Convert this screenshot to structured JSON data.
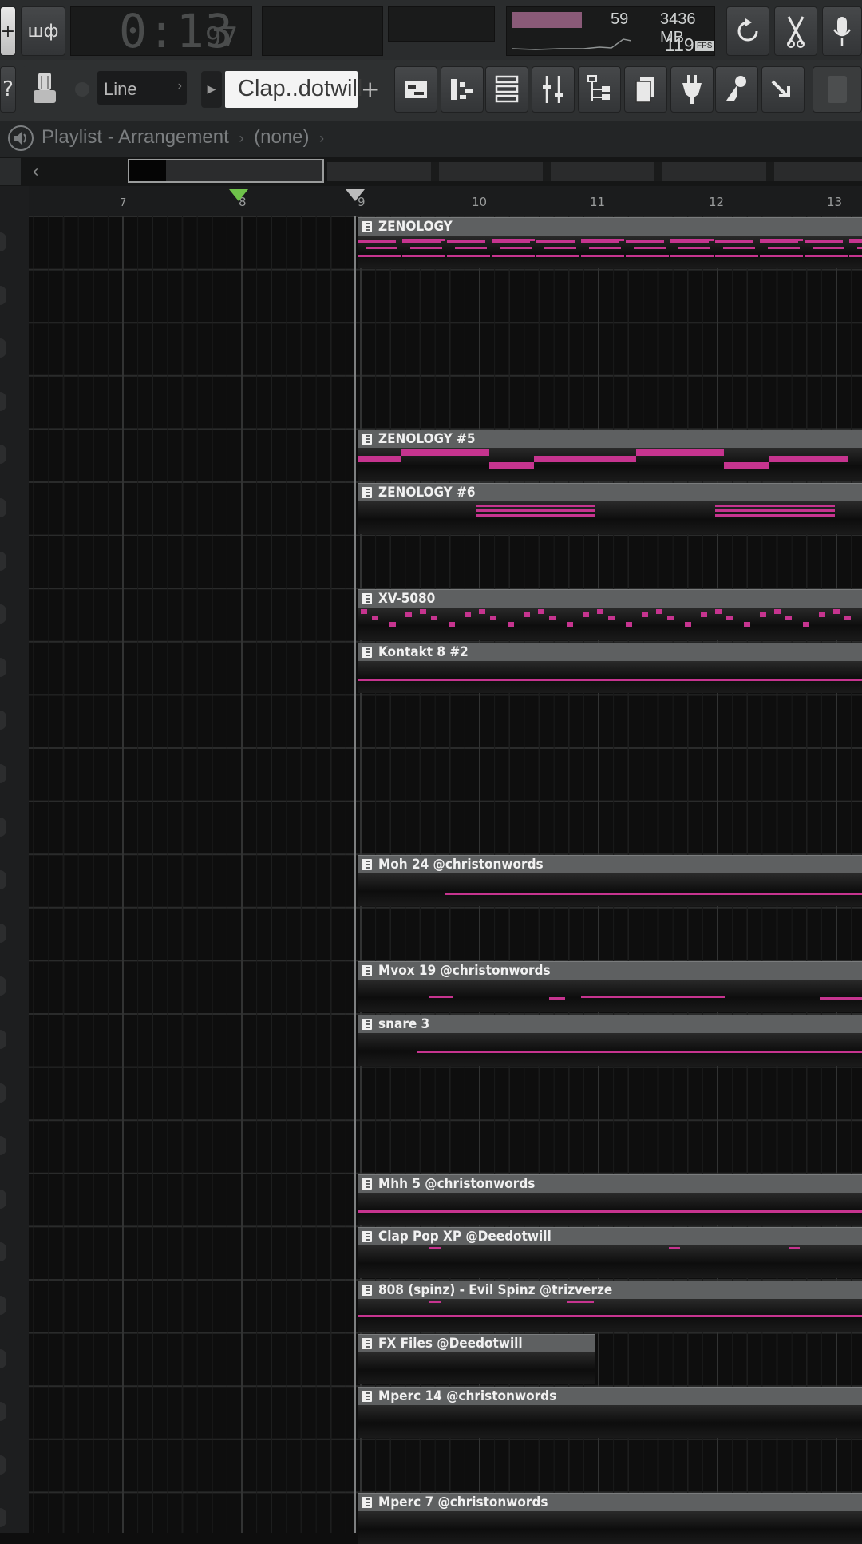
{
  "toolbar": {
    "tempo_toggle_label": "шф",
    "time_display": {
      "main": "0:13",
      "fraction": "97"
    },
    "cpu": {
      "value": "59"
    },
    "memory": {
      "value": "3436 MB",
      "polyphony": "119",
      "badge": "FPS"
    },
    "snap_mode": "Line",
    "pattern_name": "Clap..dotwill",
    "add_pattern_label": "+"
  },
  "titlebar": {
    "title": "Playlist - Arrangement",
    "separator": "›",
    "arrangement": "(none)",
    "end_arrow": "›"
  },
  "ruler": {
    "bars": [
      "7",
      "8",
      "9",
      "10",
      "11",
      "12",
      "13"
    ]
  },
  "clips": [
    {
      "name": "ZENOLOGY"
    },
    {
      "name": "ZENOLOGY #5"
    },
    {
      "name": "ZENOLOGY #6"
    },
    {
      "name": "XV-5080"
    },
    {
      "name": "Kontakt 8 #2"
    },
    {
      "name": "Moh 24 @christonwords"
    },
    {
      "name": "Mvox 19 @christonwords"
    },
    {
      "name": "snare 3"
    },
    {
      "name": "Mhh 5 @christonwords"
    },
    {
      "name": "Clap Pop XP @Deedotwill"
    },
    {
      "name": "808 (spinz) - Evil Spinz @trizverze"
    },
    {
      "name": "FX Files @Deedotwill"
    },
    {
      "name": "Mperc 14 @christonwords"
    },
    {
      "name": "Mperc 7 @christonwords"
    }
  ],
  "colors": {
    "note": "#c6348f",
    "clip_header": "#5e6061",
    "grid_bg": "#0e0e0e",
    "cpu_meter": "#8a5a78"
  }
}
